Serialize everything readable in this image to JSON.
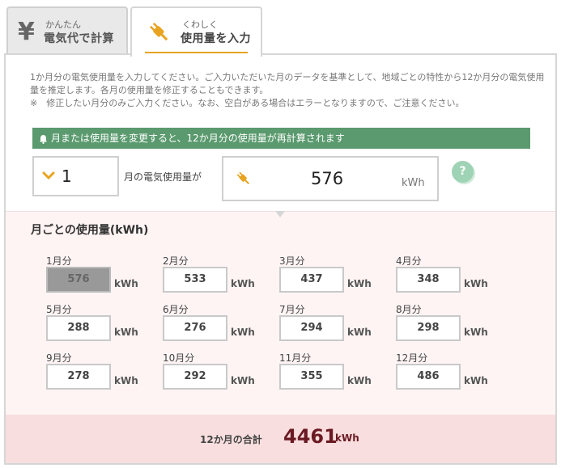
{
  "tabs": {
    "simple": {
      "ruby": "かんたん",
      "label": "電気代で計算",
      "icon": "yen-icon"
    },
    "usage": {
      "ruby": "くわしく",
      "label": "使用量を入力",
      "icon": "plug-icon"
    }
  },
  "notice": {
    "line1": "1か月分の電気使用量を入力してください。ご入力いただいた月のデータを基準として、地域ごとの特性から12か月分の電気使用量を推定します。各月の使用量を修正することもできます。",
    "line2": "※　修正したい月分のみご入力ください。なお、空白がある場合はエラーとなりますので、ご注意ください。"
  },
  "banner": {
    "text": "月または使用量を変更すると、12か月分の使用量が再計算されます"
  },
  "selector": {
    "month_value": "1",
    "month_suffix": "月の電気使用量が",
    "usage_value": "576",
    "usage_unit": "kWh",
    "help_label": "?"
  },
  "monthly": {
    "title": "月ごとの使用量(kWh)",
    "unit": "kWh",
    "months": [
      {
        "label": "1月分",
        "value": "576"
      },
      {
        "label": "2月分",
        "value": "533"
      },
      {
        "label": "3月分",
        "value": "437"
      },
      {
        "label": "4月分",
        "value": "348"
      },
      {
        "label": "5月分",
        "value": "288"
      },
      {
        "label": "6月分",
        "value": "276"
      },
      {
        "label": "7月分",
        "value": "294"
      },
      {
        "label": "8月分",
        "value": "298"
      },
      {
        "label": "9月分",
        "value": "278"
      },
      {
        "label": "10月分",
        "value": "292"
      },
      {
        "label": "11月分",
        "value": "355"
      },
      {
        "label": "12月分",
        "value": "486"
      }
    ]
  },
  "total": {
    "label": "12か月の合計",
    "value": "4461",
    "unit": "kWh"
  },
  "colors": {
    "accent": "#e8a320",
    "banner": "#5a9a6e",
    "total_value": "#6b1a24",
    "section_bg": "#fef4f4"
  }
}
